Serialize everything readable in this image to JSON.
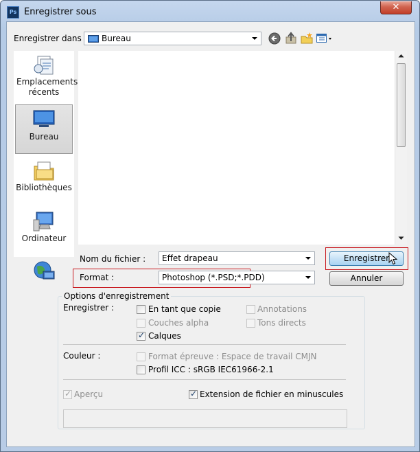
{
  "window": {
    "title": "Enregistrer sous",
    "app_icon_text": "Ps",
    "close_glyph": "✕"
  },
  "toolbar": {
    "save_in_label": "Enregistrer dans :",
    "location_value": "Bureau",
    "icons": [
      "back-icon",
      "up-folder-icon",
      "new-folder-icon",
      "view-menu-icon"
    ]
  },
  "places": [
    {
      "label": "Emplacements récents",
      "icon": "recent-places-icon",
      "selected": false
    },
    {
      "label": "Bureau",
      "icon": "desktop-icon",
      "selected": true
    },
    {
      "label": "Bibliothèques",
      "icon": "libraries-icon",
      "selected": false
    },
    {
      "label": "Ordinateur",
      "icon": "computer-icon",
      "selected": false
    },
    {
      "label": "",
      "icon": "network-icon",
      "selected": false
    }
  ],
  "file": {
    "name_label": "Nom du fichier :",
    "name_value": "Effet drapeau",
    "format_label": "Format :",
    "format_value": "Photoshop (*.PSD;*.PDD)"
  },
  "buttons": {
    "save": "Enregistrer",
    "cancel": "Annuler"
  },
  "options": {
    "group_title": "Options d'enregistrement",
    "save_label": "Enregistrer :",
    "as_copy": "En tant que copie",
    "annotations": "Annotations",
    "alpha_channels": "Couches alpha",
    "spot_colors": "Tons directs",
    "layers": "Calques",
    "color_label": "Couleur :",
    "proof_format": "Format épreuve : Espace de travail CMJN",
    "icc_profile": "Profil ICC : sRGB IEC61966-2.1",
    "preview": "Aperçu",
    "lowercase_ext": "Extension de fichier en minuscules",
    "checked": {
      "as_copy": false,
      "annotations": false,
      "alpha_channels": false,
      "spot_colors": false,
      "layers": true,
      "proof_format": false,
      "icc_profile": false,
      "preview": true,
      "lowercase_ext": true
    }
  },
  "colors": {
    "highlight_box": "#c8181e",
    "default_button": "#a9d3f2",
    "title_bar": "#b5cbe6"
  }
}
